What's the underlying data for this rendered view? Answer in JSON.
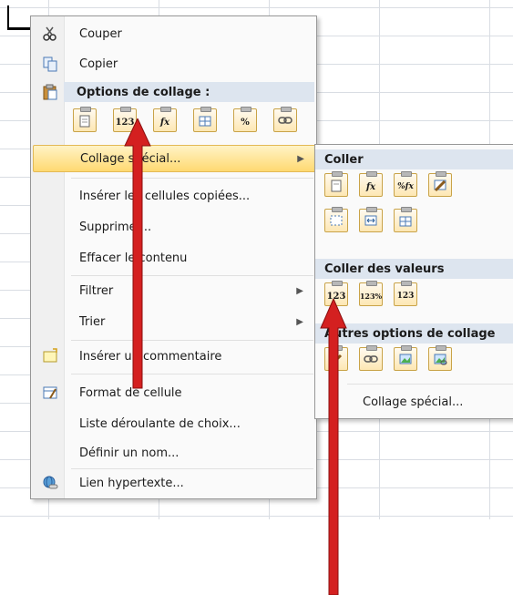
{
  "context_menu": {
    "items": {
      "cut": "Couper",
      "copy": "Copier",
      "paste_options_header": "Options de collage :",
      "paste_special": "Collage spécial...",
      "insert_copied_cells": "Insérer les cellules copiées...",
      "delete": "Supprimer...",
      "clear_contents": "Effacer le contenu",
      "filter": "Filtrer",
      "sort": "Trier",
      "insert_comment": "Insérer un commentaire",
      "format_cells": "Format de cellule",
      "dropdown_list": "Liste déroulante de choix...",
      "define_name": "Définir un nom...",
      "hyperlink": "Lien hypertexte..."
    },
    "paste_buttons": [
      "paste-icon",
      "123",
      "fx",
      "transpose-icon",
      "%",
      "link-icon"
    ]
  },
  "submenu": {
    "header_paste": "Coller",
    "header_values": "Coller des valeurs",
    "header_other": "Autres options de collage",
    "paste_special": "Collage spécial...",
    "row1": [
      "paste-icon",
      "fx",
      "%fx",
      "brush-icon"
    ],
    "row2": [
      "no-borders-icon",
      "keep-width-icon",
      "transpose-icon"
    ],
    "values_row": [
      "123",
      "123%",
      "123-brush"
    ],
    "other_row": [
      "format-icon",
      "link-icon",
      "picture-icon",
      "linked-picture-icon"
    ]
  },
  "colors": {
    "highlight": "#ffd971",
    "header_bg": "#dde5ef",
    "arrow_red": "#d42020"
  }
}
